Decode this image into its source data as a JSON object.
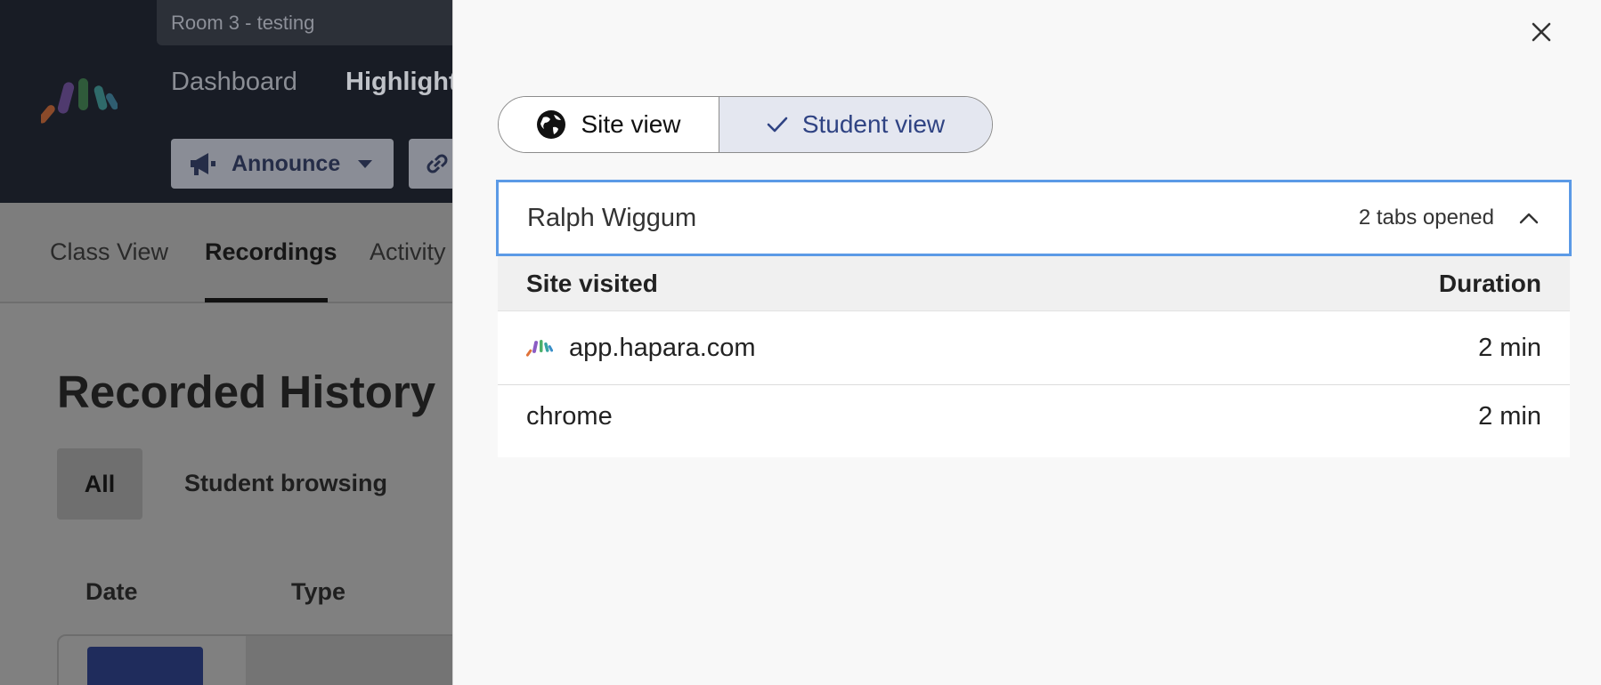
{
  "background": {
    "room_title": "Room 3 - testing",
    "nav": {
      "dashboard": "Dashboard",
      "highlights": "Highlights"
    },
    "announce_label": "Announce",
    "tabs": [
      "Class View",
      "Recordings",
      "Activity"
    ],
    "section_title": "Recorded History",
    "filters": {
      "all": "All",
      "student_browsing": "Student browsing"
    },
    "columns": {
      "date": "Date",
      "type": "Type"
    }
  },
  "panel": {
    "view_toggle": {
      "site_view": "Site view",
      "student_view": "Student view",
      "selected": "Student view"
    },
    "student": {
      "name": "Ralph Wiggum",
      "tabs_opened": "2 tabs opened",
      "expanded": true
    },
    "table": {
      "headers": {
        "site": "Site visited",
        "duration": "Duration"
      },
      "rows": [
        {
          "site": "app.hapara.com",
          "duration": "2 min",
          "icon": "hapara-logo-icon"
        },
        {
          "site": "chrome",
          "duration": "2 min"
        }
      ]
    }
  },
  "colors": {
    "header_dark": "#181c25",
    "accent_blue": "#2f4383",
    "focus_border": "#5b9ae6",
    "selected_segment": "#e4e7f0"
  }
}
